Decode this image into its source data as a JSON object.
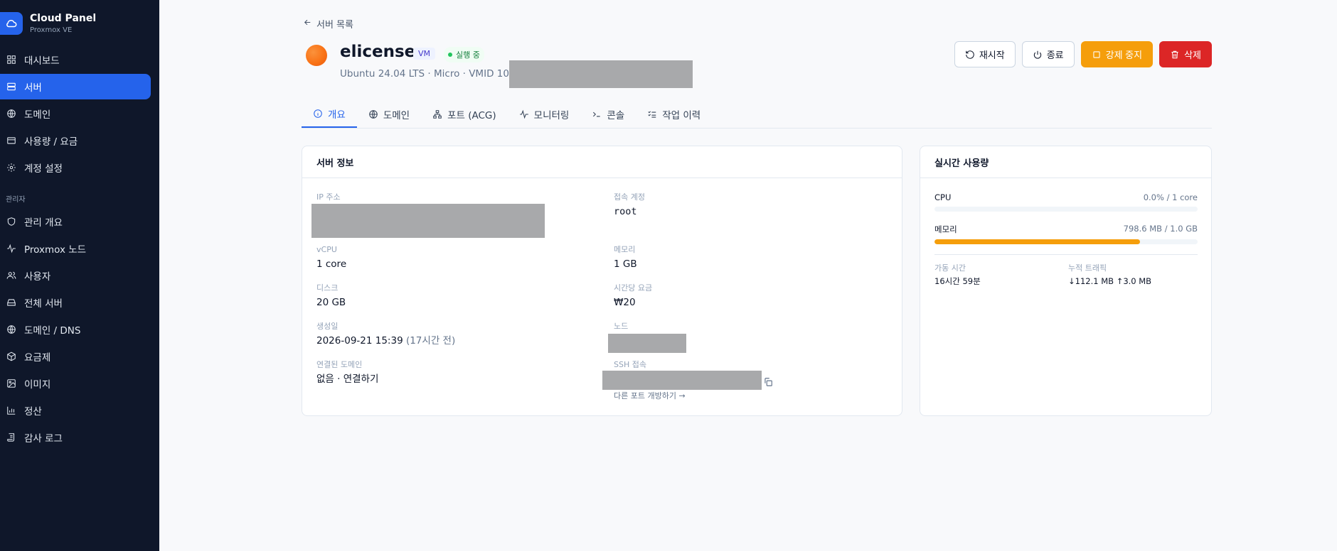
{
  "brand": {
    "title": "Cloud Panel",
    "subtitle": "Proxmox VE"
  },
  "sidebar": {
    "items": [
      {
        "label": "대시보드",
        "icon": "grid-icon"
      },
      {
        "label": "서버",
        "icon": "server-icon",
        "active": true
      },
      {
        "label": "도메인",
        "icon": "globe-icon"
      },
      {
        "label": "사용량 / 요금",
        "icon": "card-icon"
      },
      {
        "label": "계정 설정",
        "icon": "gear-icon"
      }
    ],
    "admin_section": "관리자",
    "admin_items": [
      {
        "label": "관리 개요",
        "icon": "shield-icon"
      },
      {
        "label": "Proxmox 노드",
        "icon": "activity-icon"
      },
      {
        "label": "사용자",
        "icon": "users-icon"
      },
      {
        "label": "전체 서버",
        "icon": "drive-icon"
      },
      {
        "label": "도메인 / DNS",
        "icon": "globe-icon"
      },
      {
        "label": "요금제",
        "icon": "box-icon"
      },
      {
        "label": "이미지",
        "icon": "image-icon"
      },
      {
        "label": "정산",
        "icon": "chart-icon"
      },
      {
        "label": "감사 로그",
        "icon": "scroll-icon"
      }
    ]
  },
  "back_label": "서버 목록",
  "server": {
    "name": "elicense",
    "type_badge": "VM",
    "status": "실행 중",
    "subtitle": "Ubuntu 24.04 LTS · Micro · VMID 1000"
  },
  "actions": {
    "restart": "재시작",
    "shutdown": "종료",
    "force_stop": "강제 중지",
    "delete": "삭제"
  },
  "tabs": [
    {
      "label": "개요",
      "icon": "info-icon",
      "active": true
    },
    {
      "label": "도메인",
      "icon": "globe-icon"
    },
    {
      "label": "포트 (ACG)",
      "icon": "network-icon"
    },
    {
      "label": "모니터링",
      "icon": "activity-icon"
    },
    {
      "label": "콘솔",
      "icon": "terminal-icon"
    },
    {
      "label": "작업 이력",
      "icon": "checklist-icon"
    }
  ],
  "info": {
    "title": "서버 정보",
    "ip_label": "IP 주소",
    "account_label": "접속 계정",
    "account_value": "root",
    "vcpu_label": "vCPU",
    "vcpu_value": "1 core",
    "memory_label": "메모리",
    "memory_value": "1 GB",
    "disk_label": "디스크",
    "disk_value": "20 GB",
    "hourly_label": "시간당 요금",
    "hourly_value": "₩20",
    "created_label": "생성일",
    "created_value": "2026-09-21 15:39",
    "created_relative": "(17시간 전)",
    "node_label": "노드",
    "domain_label": "연결된 도메인",
    "domain_value": "없음 · 연결하기",
    "ssh_label": "SSH 접속",
    "ssh_more": "다른 포트 개방하기 →"
  },
  "usage": {
    "title": "실시간 사용량",
    "cpu_label": "CPU",
    "cpu_value": "0.0% / 1 core",
    "cpu_fraction": 0.0,
    "mem_label": "메모리",
    "mem_value": "798.6 MB / 1.0 GB",
    "mem_fraction": 0.78,
    "uptime_label": "가동 시간",
    "uptime_value": "16시간 59분",
    "traffic_label": "누적 트래픽",
    "traffic_value": "↓112.1 MB ↑3.0 MB"
  },
  "colors": {
    "sidebar_bg": "#0f172a",
    "accent": "#2563eb",
    "warn": "#f59e0b",
    "danger": "#dc2626"
  }
}
